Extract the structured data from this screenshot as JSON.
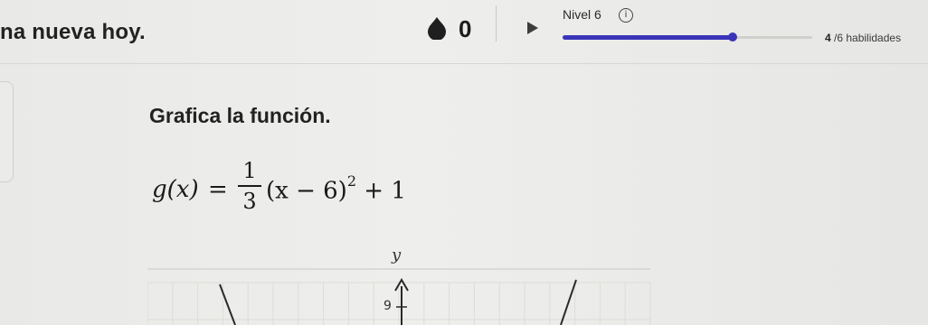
{
  "header": {
    "streak_text": "na nueva hoy.",
    "points": "0",
    "level_label": "Nivel 6",
    "info_glyph": "i",
    "progress_fraction": 0.68,
    "skills_done": "4",
    "skills_rest": " /6 habilidades"
  },
  "icons": {
    "points": "drop-icon",
    "play": "play-icon",
    "info": "info-icon"
  },
  "colors": {
    "accent": "#3a35b8",
    "background": "#ebebea"
  },
  "problem": {
    "prompt": "Grafica la función.",
    "fn_name": "g(x)",
    "equals": "=",
    "numerator": "1",
    "denominator": "3",
    "rest_base": "(x − 6)",
    "exponent": "2",
    "rest_tail": " + 1"
  },
  "graph": {
    "y_label": "y",
    "tick_label": "9"
  }
}
